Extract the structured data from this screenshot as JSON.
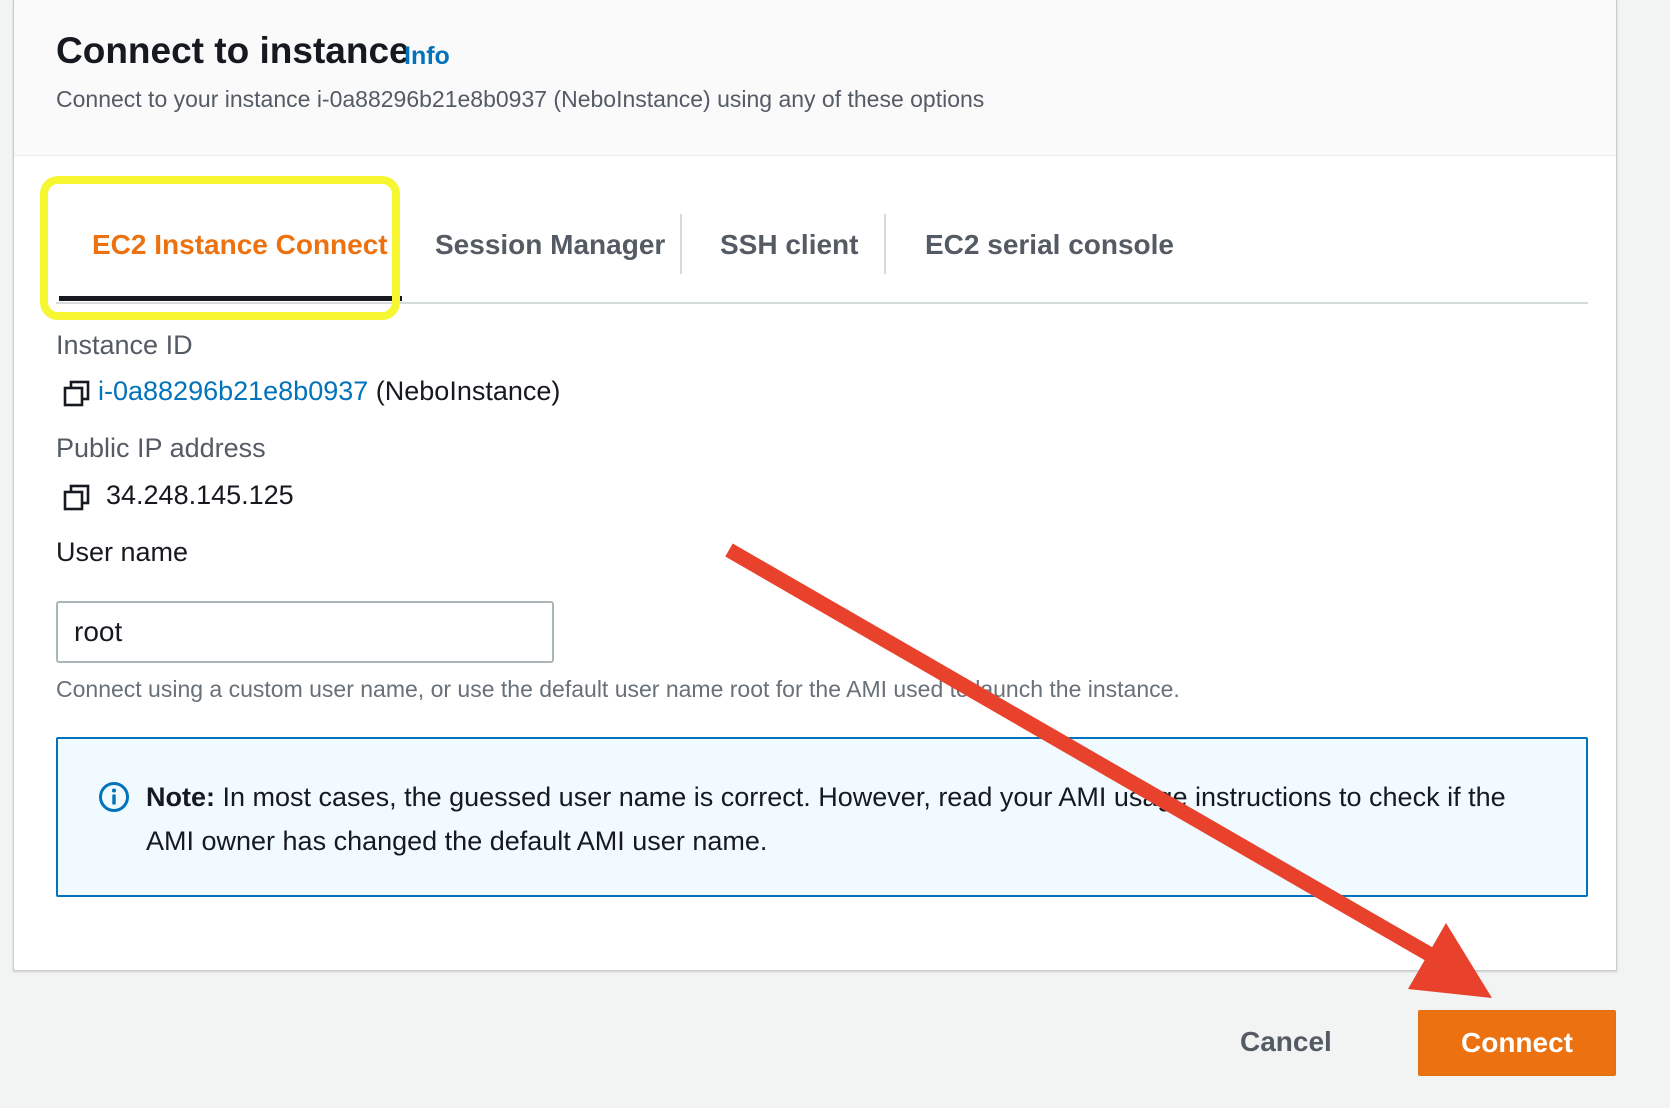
{
  "dialog": {
    "title": "Connect to instance",
    "info_link": "Info",
    "subtitle": "Connect to your instance i-0a88296b21e8b0937 (NeboInstance) using any of these options"
  },
  "tabs": [
    {
      "label": "EC2 Instance Connect",
      "active": true
    },
    {
      "label": "Session Manager",
      "active": false
    },
    {
      "label": "SSH client",
      "active": false
    },
    {
      "label": "EC2 serial console",
      "active": false
    }
  ],
  "instance_id": {
    "label": "Instance ID",
    "value": "i-0a88296b21e8b0937",
    "name": "(NeboInstance)"
  },
  "public_ip": {
    "label": "Public IP address",
    "value": "34.248.145.125"
  },
  "user_name": {
    "label": "User name",
    "value": "root",
    "hint": "Connect using a custom user name, or use the default user name root for the AMI used to launch the instance."
  },
  "note": {
    "label": "Note:",
    "text": " In most cases, the guessed user name is correct. However, read your AMI usage instructions to check if the AMI owner has changed the default AMI user name."
  },
  "footer": {
    "cancel_label": "Cancel",
    "connect_label": "Connect"
  },
  "colors": {
    "accent": "#ec7211",
    "link": "#0073bb",
    "highlight": "#f7f731",
    "annotation_arrow": "#e8412c"
  },
  "icons": {
    "copy": "copy-icon",
    "info": "info-circle-icon"
  }
}
